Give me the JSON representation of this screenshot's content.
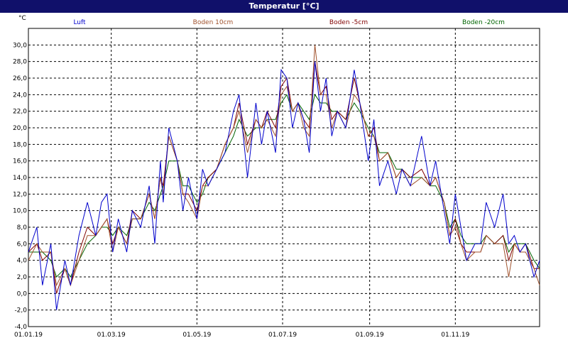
{
  "window": {
    "title": "Temperatur [°C]"
  },
  "chart_data": {
    "type": "line",
    "title": "Temperatur [°C]",
    "ylabel": "°C",
    "xlabel": "",
    "ylim": [
      -4,
      32
    ],
    "yticks": [
      -4,
      -2,
      0,
      2,
      4,
      6,
      8,
      10,
      12,
      14,
      16,
      18,
      20,
      22,
      24,
      26,
      28,
      30
    ],
    "ytick_labels": [
      "-4,0",
      "-2,0",
      "0,0",
      "2,0",
      "4,0",
      "6,0",
      "8,0",
      "10,0",
      "12,0",
      "14,0",
      "16,0",
      "18,0",
      "20,0",
      "22,0",
      "24,0",
      "26,0",
      "28,0",
      "30,0"
    ],
    "x_unit": "day_of_year_2019",
    "xlim": [
      0,
      364
    ],
    "xticks": [
      0,
      59,
      120,
      181,
      243,
      304
    ],
    "xtick_labels": [
      "01.01.19",
      "01.03.19",
      "01.05.19",
      "01.07.19",
      "01.09.19",
      "01.11.19"
    ],
    "grid": true,
    "legend_placement": "top",
    "series": [
      {
        "name": "Luft",
        "color": "#0000cc",
        "x": [
          0,
          6,
          10,
          16,
          20,
          26,
          30,
          36,
          42,
          48,
          52,
          56,
          60,
          64,
          70,
          74,
          80,
          86,
          90,
          94,
          96,
          100,
          106,
          110,
          114,
          120,
          124,
          128,
          134,
          140,
          146,
          150,
          156,
          162,
          166,
          170,
          176,
          180,
          184,
          188,
          192,
          196,
          200,
          204,
          208,
          212,
          216,
          220,
          226,
          232,
          236,
          242,
          246,
          250,
          256,
          262,
          266,
          272,
          280,
          286,
          290,
          296,
          300,
          304,
          308,
          312,
          318,
          322,
          326,
          332,
          338,
          342,
          346,
          350,
          354,
          360,
          364
        ],
        "values": [
          5,
          8,
          1,
          6,
          -2,
          4,
          1,
          7,
          11,
          7,
          11,
          12,
          5,
          9,
          5,
          10,
          8,
          13,
          6,
          16,
          11,
          20,
          16,
          10,
          14,
          9,
          15,
          13,
          15,
          17,
          22,
          24,
          14,
          23,
          18,
          22,
          17,
          27,
          26,
          20,
          23,
          21,
          17,
          28,
          22,
          26,
          19,
          22,
          20,
          27,
          23,
          16,
          21,
          13,
          16,
          12,
          15,
          13,
          19,
          13,
          16,
          10,
          6,
          12,
          8,
          4,
          6,
          6,
          11,
          8,
          12,
          6,
          7,
          5,
          6,
          2,
          4
        ]
      },
      {
        "name": "Boden 10cm",
        "color": "#a0522d",
        "x": [
          0,
          6,
          10,
          16,
          20,
          26,
          30,
          36,
          42,
          48,
          52,
          56,
          60,
          64,
          70,
          74,
          80,
          86,
          90,
          94,
          96,
          100,
          106,
          110,
          114,
          120,
          124,
          128,
          134,
          140,
          146,
          150,
          156,
          162,
          166,
          170,
          176,
          180,
          184,
          188,
          192,
          196,
          200,
          204,
          208,
          212,
          216,
          220,
          226,
          232,
          236,
          242,
          246,
          250,
          256,
          262,
          266,
          272,
          280,
          286,
          290,
          296,
          300,
          304,
          308,
          312,
          318,
          322,
          326,
          332,
          338,
          342,
          346,
          350,
          354,
          360,
          364
        ],
        "values": [
          4,
          6,
          5,
          5,
          1,
          3,
          1,
          4,
          7,
          7,
          8,
          9,
          5,
          8,
          6,
          9,
          9,
          12,
          9,
          14,
          12,
          19,
          16,
          12,
          11,
          9,
          13,
          13,
          15,
          18,
          20,
          22,
          17,
          21,
          20,
          21,
          19,
          24,
          25,
          22,
          23,
          20,
          19,
          30,
          24,
          24,
          20,
          22,
          20,
          24,
          23,
          19,
          19,
          16,
          17,
          14,
          15,
          13,
          14,
          13,
          14,
          11,
          7,
          8,
          6,
          4,
          5,
          5,
          7,
          6,
          6,
          2,
          6,
          5,
          5,
          3,
          1
        ]
      },
      {
        "name": "Boden -5cm",
        "color": "#800000",
        "x": [
          0,
          6,
          10,
          16,
          20,
          26,
          30,
          36,
          42,
          48,
          52,
          56,
          60,
          64,
          70,
          74,
          80,
          86,
          90,
          94,
          96,
          100,
          106,
          110,
          114,
          120,
          124,
          128,
          134,
          140,
          146,
          150,
          156,
          162,
          166,
          170,
          176,
          180,
          184,
          188,
          192,
          196,
          200,
          204,
          208,
          212,
          216,
          220,
          226,
          232,
          236,
          242,
          246,
          250,
          256,
          262,
          266,
          272,
          280,
          286,
          290,
          296,
          300,
          304,
          308,
          312,
          318,
          322,
          326,
          332,
          338,
          342,
          346,
          350,
          354,
          360,
          364
        ],
        "values": [
          5,
          6,
          4,
          5,
          0,
          3,
          1,
          5,
          8,
          7,
          8,
          9,
          6,
          8,
          6,
          10,
          9,
          12,
          9,
          14,
          13,
          19,
          16,
          12,
          12,
          10,
          13,
          14,
          15,
          18,
          20,
          23,
          18,
          21,
          20,
          22,
          20,
          25,
          26,
          22,
          23,
          21,
          20,
          28,
          24,
          25,
          21,
          22,
          21,
          26,
          23,
          19,
          20,
          16,
          17,
          14,
          15,
          14,
          15,
          13,
          14,
          11,
          7,
          9,
          6,
          5,
          5,
          5,
          7,
          6,
          7,
          4,
          6,
          5,
          6,
          3,
          3
        ]
      },
      {
        "name": "Boden -20cm",
        "color": "#006400",
        "x": [
          0,
          6,
          10,
          16,
          20,
          26,
          30,
          36,
          42,
          48,
          52,
          56,
          60,
          64,
          70,
          74,
          80,
          86,
          90,
          94,
          96,
          100,
          106,
          110,
          114,
          120,
          124,
          128,
          134,
          140,
          146,
          150,
          156,
          162,
          166,
          170,
          176,
          180,
          184,
          188,
          192,
          196,
          200,
          204,
          208,
          212,
          216,
          220,
          226,
          232,
          236,
          242,
          246,
          250,
          256,
          262,
          266,
          272,
          280,
          286,
          290,
          296,
          300,
          304,
          308,
          312,
          318,
          322,
          326,
          332,
          338,
          342,
          346,
          350,
          354,
          360,
          364
        ],
        "values": [
          5,
          5,
          5,
          4,
          2,
          3,
          2,
          4,
          6,
          7,
          8,
          8,
          7,
          8,
          7,
          9,
          9,
          11,
          10,
          12,
          13,
          16,
          16,
          13,
          13,
          11,
          12,
          14,
          15,
          17,
          19,
          21,
          19,
          20,
          20,
          21,
          21,
          23,
          24,
          22,
          23,
          22,
          21,
          24,
          23,
          23,
          22,
          22,
          21,
          23,
          22,
          20,
          19,
          17,
          17,
          15,
          15,
          14,
          14,
          13,
          13,
          11,
          8,
          9,
          7,
          6,
          6,
          6,
          7,
          6,
          7,
          5,
          6,
          6,
          6,
          4,
          3
        ]
      }
    ]
  }
}
